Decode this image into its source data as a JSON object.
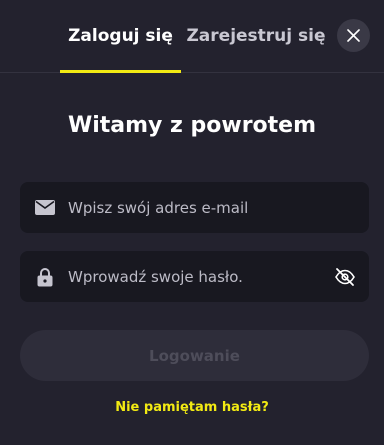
{
  "tabs": {
    "login_label": "Zaloguj się",
    "register_label": "Zarejestruj się",
    "active": "login"
  },
  "close": {
    "icon": "close-icon"
  },
  "title": "Witamy z powrotem",
  "email": {
    "placeholder": "Wpisz swój adres e-mail",
    "value": "",
    "icon": "envelope-icon"
  },
  "password": {
    "placeholder": "Wprowadź swoje hasło.",
    "value": "",
    "icon": "lock-icon",
    "toggle_icon": "eye-slash-icon"
  },
  "submit": {
    "label": "Logowanie",
    "disabled": true
  },
  "forgot": {
    "label": "Nie pamiętam hasła?"
  },
  "colors": {
    "background": "#23222e",
    "field_background": "#181820",
    "accent": "#f2ea13",
    "button_disabled_bg": "#2e2d3a",
    "button_disabled_text": "#4e4d5a"
  }
}
